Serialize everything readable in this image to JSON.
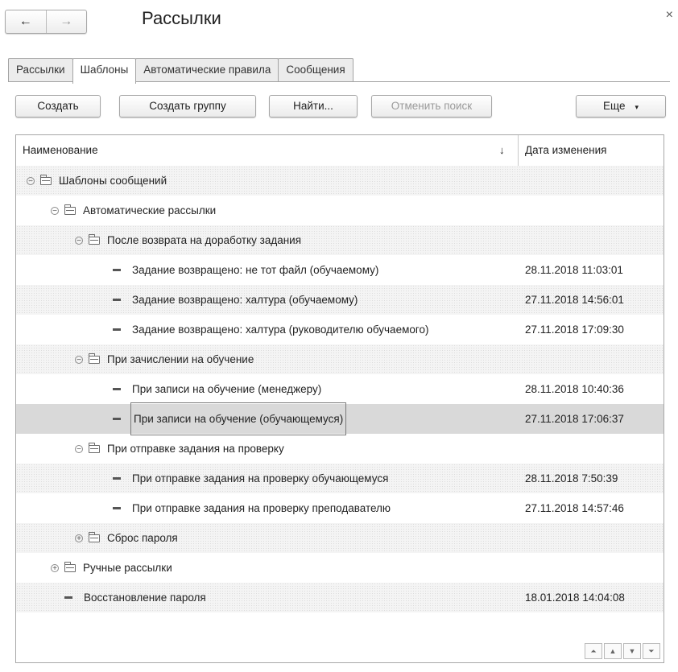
{
  "window": {
    "title": "Рассылки",
    "close_glyph": "×"
  },
  "nav": {
    "back_glyph": "🡐",
    "forward_glyph": "→",
    "back_icon": "arrow-left-icon",
    "forward_icon": "arrow-right-icon"
  },
  "tabs": [
    {
      "label": "Рассылки",
      "active": false
    },
    {
      "label": "Шаблоны",
      "active": true
    },
    {
      "label": "Автоматические правила",
      "active": false
    },
    {
      "label": "Сообщения",
      "active": false
    }
  ],
  "toolbar": {
    "create_label": "Создать",
    "create_group_label": "Создать группу",
    "find_label": "Найти...",
    "cancel_search_label": "Отменить поиск",
    "more_label": "Еще",
    "more_caret": "▾"
  },
  "grid": {
    "columns": {
      "name": "Наименование",
      "date": "Дата изменения",
      "sort_glyph": "↓"
    },
    "rows": [
      {
        "type": "folder",
        "level": 0,
        "expanded": true,
        "name": "Шаблоны сообщений",
        "date": ""
      },
      {
        "type": "folder",
        "level": 1,
        "expanded": true,
        "name": "Автоматические рассылки",
        "date": ""
      },
      {
        "type": "folder",
        "level": 2,
        "expanded": true,
        "name": "После возврата на доработку задания",
        "date": ""
      },
      {
        "type": "item",
        "level": 3,
        "name": "Задание возвращено: не тот файл (обучаемому)",
        "date": "28.11.2018 11:03:01"
      },
      {
        "type": "item",
        "level": 3,
        "name": "Задание возвращено: халтура (обучаемому)",
        "date": "27.11.2018 14:56:01"
      },
      {
        "type": "item",
        "level": 3,
        "name": "Задание возвращено: халтура (руководителю обучаемого)",
        "date": "27.11.2018 17:09:30"
      },
      {
        "type": "folder",
        "level": 2,
        "expanded": true,
        "name": "При зачислении на обучение",
        "date": ""
      },
      {
        "type": "item",
        "level": 3,
        "name": "При записи на обучение (менеджеру)",
        "date": "28.11.2018 10:40:36"
      },
      {
        "type": "item",
        "level": 3,
        "name": "При записи на обучение (обучающемуся)",
        "date": "27.11.2018 17:06:37",
        "selected": true
      },
      {
        "type": "folder",
        "level": 2,
        "expanded": true,
        "name": "При отправке задания на проверку",
        "date": ""
      },
      {
        "type": "item",
        "level": 3,
        "name": "При отправке задания на проверку обучающемуся",
        "date": "28.11.2018 7:50:39"
      },
      {
        "type": "item",
        "level": 3,
        "name": "При отправке задания на проверку преподавателю",
        "date": "27.11.2018 14:57:46"
      },
      {
        "type": "folder",
        "level": 2,
        "expanded": false,
        "name": "Сброс пароля",
        "date": ""
      },
      {
        "type": "folder",
        "level": 1,
        "expanded": false,
        "name": "Ручные рассылки",
        "date": ""
      },
      {
        "type": "item",
        "level": 1,
        "name": "Восстановление пароля",
        "date": "18.01.2018 14:04:08"
      }
    ]
  },
  "scroll_nav": {
    "first_glyph": "⏶",
    "prev_glyph": "▲",
    "next_glyph": "▼",
    "last_glyph": "⏷"
  }
}
